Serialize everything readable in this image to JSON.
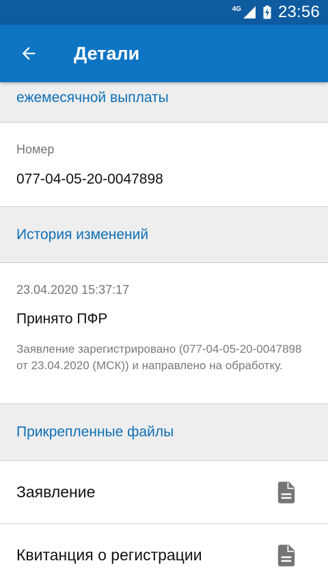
{
  "status_bar": {
    "network": "4G",
    "time": "23:56"
  },
  "app_bar": {
    "title": "Детали",
    "back_icon": "arrow-left-icon"
  },
  "sections": {
    "top_header_partial": "ежемесячной выплаты",
    "number": {
      "label": "Номер",
      "value": "077-04-05-20-0047898"
    },
    "history": {
      "header": "История изменений",
      "entries": [
        {
          "date": "23.04.2020 15:37:17",
          "title": "Принято ПФР",
          "description": "Заявление зарегистрировано (077-04-05-20-0047898 от 23.04.2020 (МСК)) и направлено на обработку."
        }
      ]
    },
    "files": {
      "header": "Прикрепленные файлы",
      "items": [
        {
          "label": "Заявление",
          "icon": "document-icon"
        },
        {
          "label": "Квитанция о регистрации",
          "icon": "document-icon"
        }
      ]
    }
  },
  "colors": {
    "status_bar": "#0E5BA0",
    "app_bar": "#0E75C4",
    "section_header_text": "#0E6FB6",
    "section_header_bg": "#EEEEEE",
    "divider": "#CFCFCF",
    "icon_gray": "#757575"
  }
}
